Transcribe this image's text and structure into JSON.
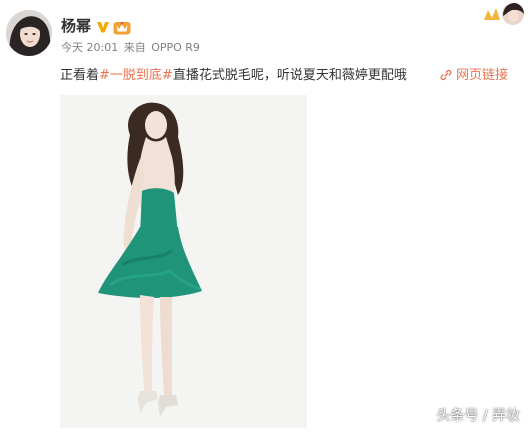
{
  "post": {
    "username": "杨幂",
    "verified_icon": "verified-v-icon",
    "member_icon": "member-crown-icon",
    "time": "今天 20:01",
    "source_prefix": "来自",
    "source": "OPPO R9",
    "text_before": "正看着",
    "hashtag": "#一脱到底#",
    "text_after": "直播花式脱毛呢，听说夏天和薇婷更配哦",
    "link_label": "网页链接",
    "link_icon": "link-icon"
  },
  "watermark": {
    "text": "头条号 / 弄妆"
  },
  "colors": {
    "accent": "#eb7350",
    "meta": "#808080",
    "verified": "#f6a800",
    "dress": "#1f9478"
  }
}
